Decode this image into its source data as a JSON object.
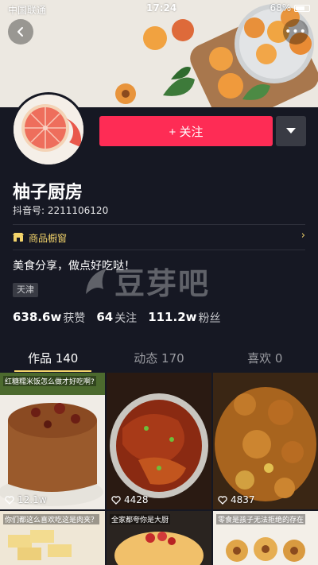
{
  "status_bar": {
    "carrier": "中国联通",
    "time": "17:24",
    "battery": "68%"
  },
  "profile": {
    "name": "柚子厨房",
    "douyin_id": "抖音号: 2211106120",
    "shop_label": "商品橱窗",
    "bio": "美食分享，做点好吃哒！",
    "location": "天津",
    "follow_label": "+ 关注",
    "stats": [
      {
        "value": "638.6w",
        "label": "获赞"
      },
      {
        "value": "64",
        "label": "关注"
      },
      {
        "value": "111.2w",
        "label": "粉丝"
      }
    ]
  },
  "watermark": "豆芽吧",
  "tabs": [
    {
      "label": "作品 140",
      "active": true
    },
    {
      "label": "动态 170",
      "active": false
    },
    {
      "label": "喜欢 0",
      "active": false
    }
  ],
  "videos": [
    {
      "caption": "红糖糯米饭怎么做才好吃啊?",
      "likes": "12.1w"
    },
    {
      "caption": "",
      "likes": "4428"
    },
    {
      "caption": "",
      "likes": "4837"
    },
    {
      "caption": "你们都这么喜欢吃这是肉夹？",
      "likes": ""
    },
    {
      "caption": "全家都夸你是大厨",
      "likes": ""
    },
    {
      "caption": "零食是孩子无法拒绝的存在",
      "likes": ""
    }
  ],
  "colors": {
    "accent": "#fe2c55",
    "shop": "#f3d46b",
    "background": "#161823"
  }
}
